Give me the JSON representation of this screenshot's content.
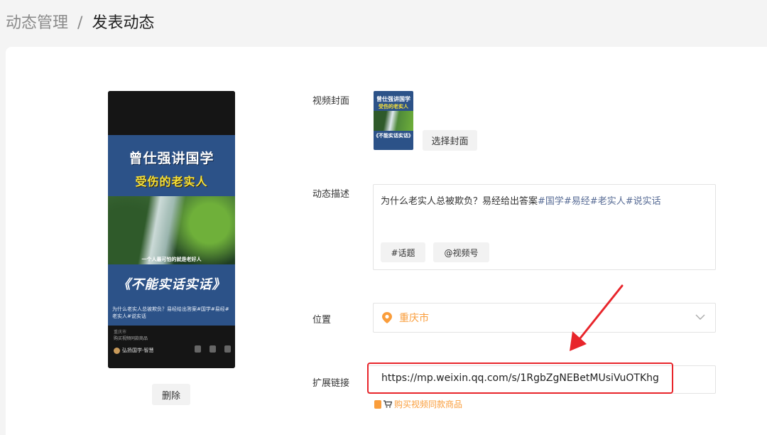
{
  "breadcrumb": {
    "parent": "动态管理",
    "separator": "/",
    "current": "发表动态"
  },
  "preview": {
    "cover_title": "曾仕强讲国学",
    "cover_subtitle": "受伤的老实人",
    "photo_caption": "一个人最可怕的就是老好人",
    "cover_title2": "《不能实话实话》",
    "caption": "为什么老实人总被欺负？易经给出答案#国学#易经#老实人#说实话",
    "location": "重庆市",
    "shop_text": "购买视频同款商品",
    "author": "弘扬国学-智慧"
  },
  "delete_label": "删除",
  "form": {
    "cover_label": "视频封面",
    "choose_cover_label": "选择封面",
    "desc_label": "动态描述",
    "desc_text": "为什么老实人总被欺负？易经给出答案",
    "desc_tags": "#国学#易经#老实人#说实话",
    "topic_chip": "#话题",
    "channel_chip": "@视频号",
    "location_label": "位置",
    "location_value": "重庆市",
    "link_label": "扩展链接",
    "link_value": "https://mp.weixin.qq.com/s/1RgbZgNEBetMUsiVuOTKhg",
    "buy_link": "购买视频同款商品"
  },
  "thumb": {
    "t1": "曾仕强讲国学",
    "t2": "受伤的老实人",
    "t3": "《不能实话实话》"
  },
  "colors": {
    "accent": "#fa9d3b",
    "tag": "#576b95",
    "highlight": "#e8252b"
  }
}
